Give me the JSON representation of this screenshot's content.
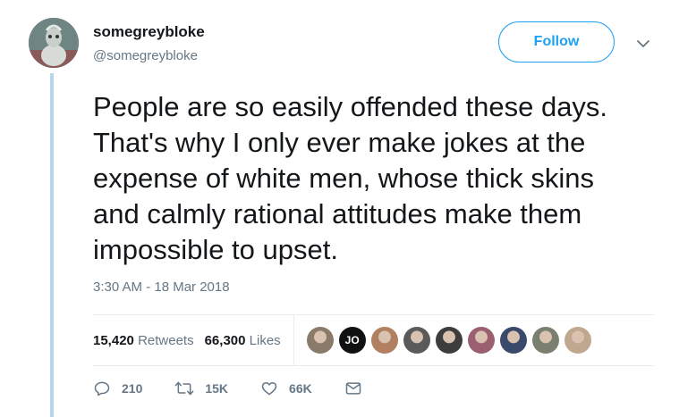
{
  "user": {
    "display_name": "somegreybloke",
    "handle": "@somegreybloke",
    "avatar_icon": "grey-figure-avatar"
  },
  "header": {
    "follow_label": "Follow",
    "menu_icon": "chevron-down-icon"
  },
  "tweet": {
    "text": "People are so easily offended these days.\nThat's why I only ever make jokes at the\nexpense of white men, whose thick skins\nand calmly rational attitudes make them\nimpossible to upset.",
    "timestamp": "3:30 AM - 18 Mar 2018"
  },
  "stats": {
    "retweets_count": "15,420",
    "retweets_label": "Retweets",
    "likes_count": "66,300",
    "likes_label": "Likes"
  },
  "likers": [
    {
      "kind": "photo",
      "color": "#8a7a6a"
    },
    {
      "kind": "initials",
      "text": "JO"
    },
    {
      "kind": "photo",
      "color": "#b08060"
    },
    {
      "kind": "photo",
      "color": "#5a5a5a"
    },
    {
      "kind": "photo",
      "color": "#3d3d3d"
    },
    {
      "kind": "photo",
      "color": "#9a6070"
    },
    {
      "kind": "photo",
      "color": "#3a4a6a"
    },
    {
      "kind": "photo",
      "color": "#7a8070"
    },
    {
      "kind": "photo",
      "color": "#c0a890"
    }
  ],
  "actions": {
    "replies": "210",
    "retweets": "15K",
    "likes": "66K"
  },
  "colors": {
    "accent": "#1da1f2",
    "muted": "#657786",
    "thread_line": "#b4d7ef",
    "divider": "#e6ecf0"
  }
}
